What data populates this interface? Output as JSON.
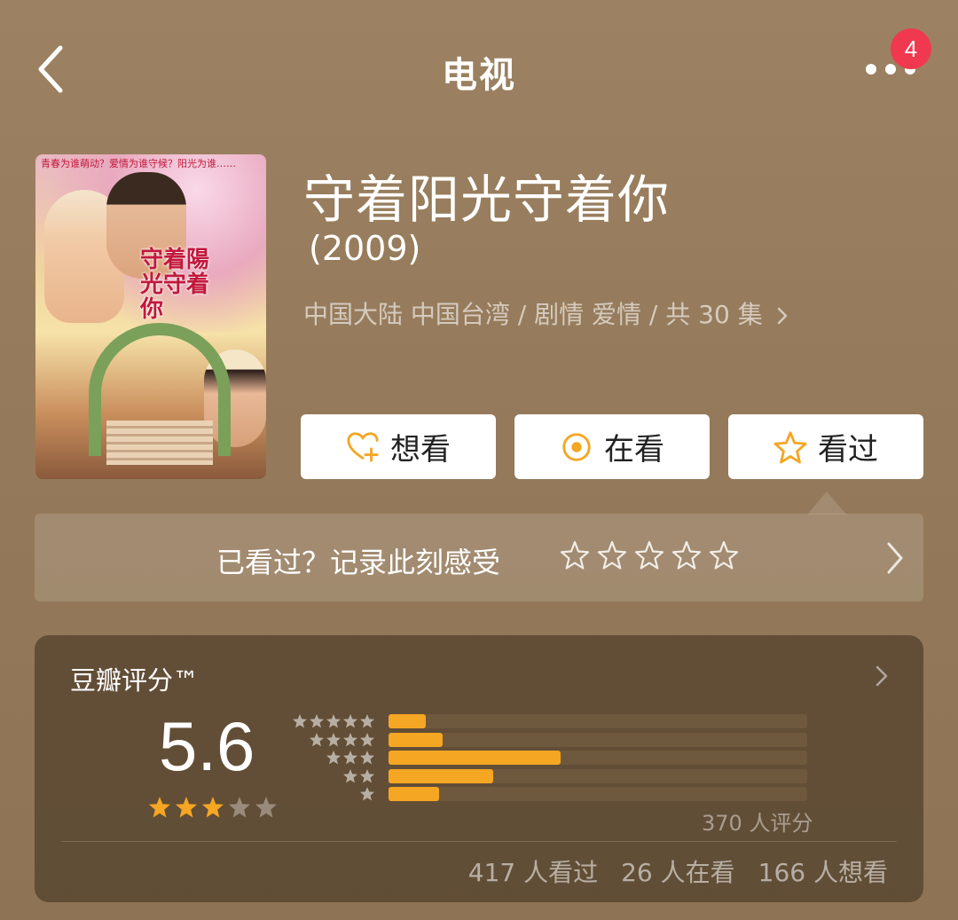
{
  "header": {
    "title": "电视",
    "notification_count": "4"
  },
  "poster": {
    "title_overlay": "守着陽光守着你",
    "tagline": "青春为谁萌动？爱情为谁守候？阳光为谁……"
  },
  "show": {
    "title": "守着阳光守着你",
    "year": "(2009)",
    "meta": "中国大陆 中国台湾 / 剧情 爱情 / 共 30 集"
  },
  "actions": {
    "want": "想看",
    "watching": "在看",
    "watched": "看过"
  },
  "record": {
    "prompt": "已看过？记录此刻感受",
    "stars": 0
  },
  "rating": {
    "label": "豆瓣评分™",
    "score": "5.6",
    "stars": 3,
    "count_text": "370 人评分",
    "distribution": [
      {
        "stars": 5,
        "fraction": 0.09
      },
      {
        "stars": 4,
        "fraction": 0.13
      },
      {
        "stars": 3,
        "fraction": 0.41
      },
      {
        "stars": 2,
        "fraction": 0.25
      },
      {
        "stars": 1,
        "fraction": 0.12
      }
    ],
    "stats": {
      "watched": "417 人看过",
      "watching": "26 人在看",
      "want": "166 人想看"
    }
  },
  "colors": {
    "accent": "#f5a623",
    "badge": "#f0394f",
    "background": "#9a8060"
  }
}
